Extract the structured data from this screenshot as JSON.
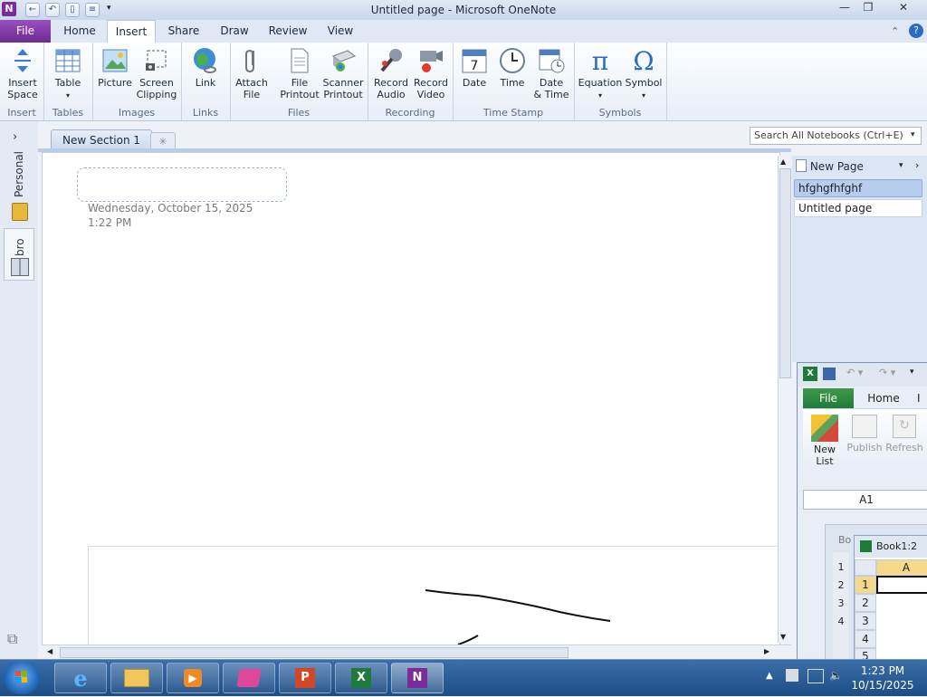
{
  "window": {
    "title": "Untitled page - Microsoft OneNote",
    "app_icon_letter": "N"
  },
  "tabs": [
    "File",
    "Home",
    "Insert",
    "Share",
    "Draw",
    "Review",
    "View"
  ],
  "active_tab": "Insert",
  "ribbon": {
    "groups": [
      {
        "label": "Insert",
        "buttons": [
          "Insert\nSpace"
        ]
      },
      {
        "label": "Tables",
        "buttons": [
          "Table"
        ]
      },
      {
        "label": "Images",
        "buttons": [
          "Picture",
          "Screen\nClipping"
        ]
      },
      {
        "label": "Links",
        "buttons": [
          "Link"
        ]
      },
      {
        "label": "Files",
        "buttons": [
          "Attach\nFile",
          "File\nPrintout",
          "Scanner\nPrintout"
        ]
      },
      {
        "label": "Recording",
        "buttons": [
          "Record\nAudio",
          "Record\nVideo"
        ]
      },
      {
        "label": "Time Stamp",
        "buttons": [
          "Date",
          "Time",
          "Date\n& Time"
        ]
      },
      {
        "label": "Symbols",
        "buttons": [
          "Equation",
          "Symbol"
        ]
      }
    ],
    "equation_glyph": "π",
    "symbol_glyph": "Ω"
  },
  "notebooks": [
    "Personal",
    "bro"
  ],
  "section": {
    "name": "New Section 1"
  },
  "page": {
    "date": "Wednesday, October 15, 2025",
    "time": "1:22 PM"
  },
  "search": {
    "placeholder": "Search All Notebooks (Ctrl+E)"
  },
  "page_list": {
    "new_page_label": "New Page",
    "pages": [
      {
        "title": "hfghgfhfghf",
        "selected": true
      },
      {
        "title": "Untitled page",
        "selected": false
      }
    ]
  },
  "excel": {
    "tabs": [
      "File",
      "Home",
      "I"
    ],
    "buttons": [
      "New\nList",
      "Publish",
      "Refresh"
    ],
    "name_box": "A1",
    "sheet_title": "Book1:2",
    "sheet_prefix": "Bo",
    "col_header": "A",
    "rows": [
      "1",
      "2",
      "3",
      "4",
      "5"
    ],
    "inner_rows": [
      "1",
      "2",
      "3",
      "4"
    ]
  },
  "taskbar": {
    "time": "1:23 PM",
    "date": "10/15/2025"
  }
}
